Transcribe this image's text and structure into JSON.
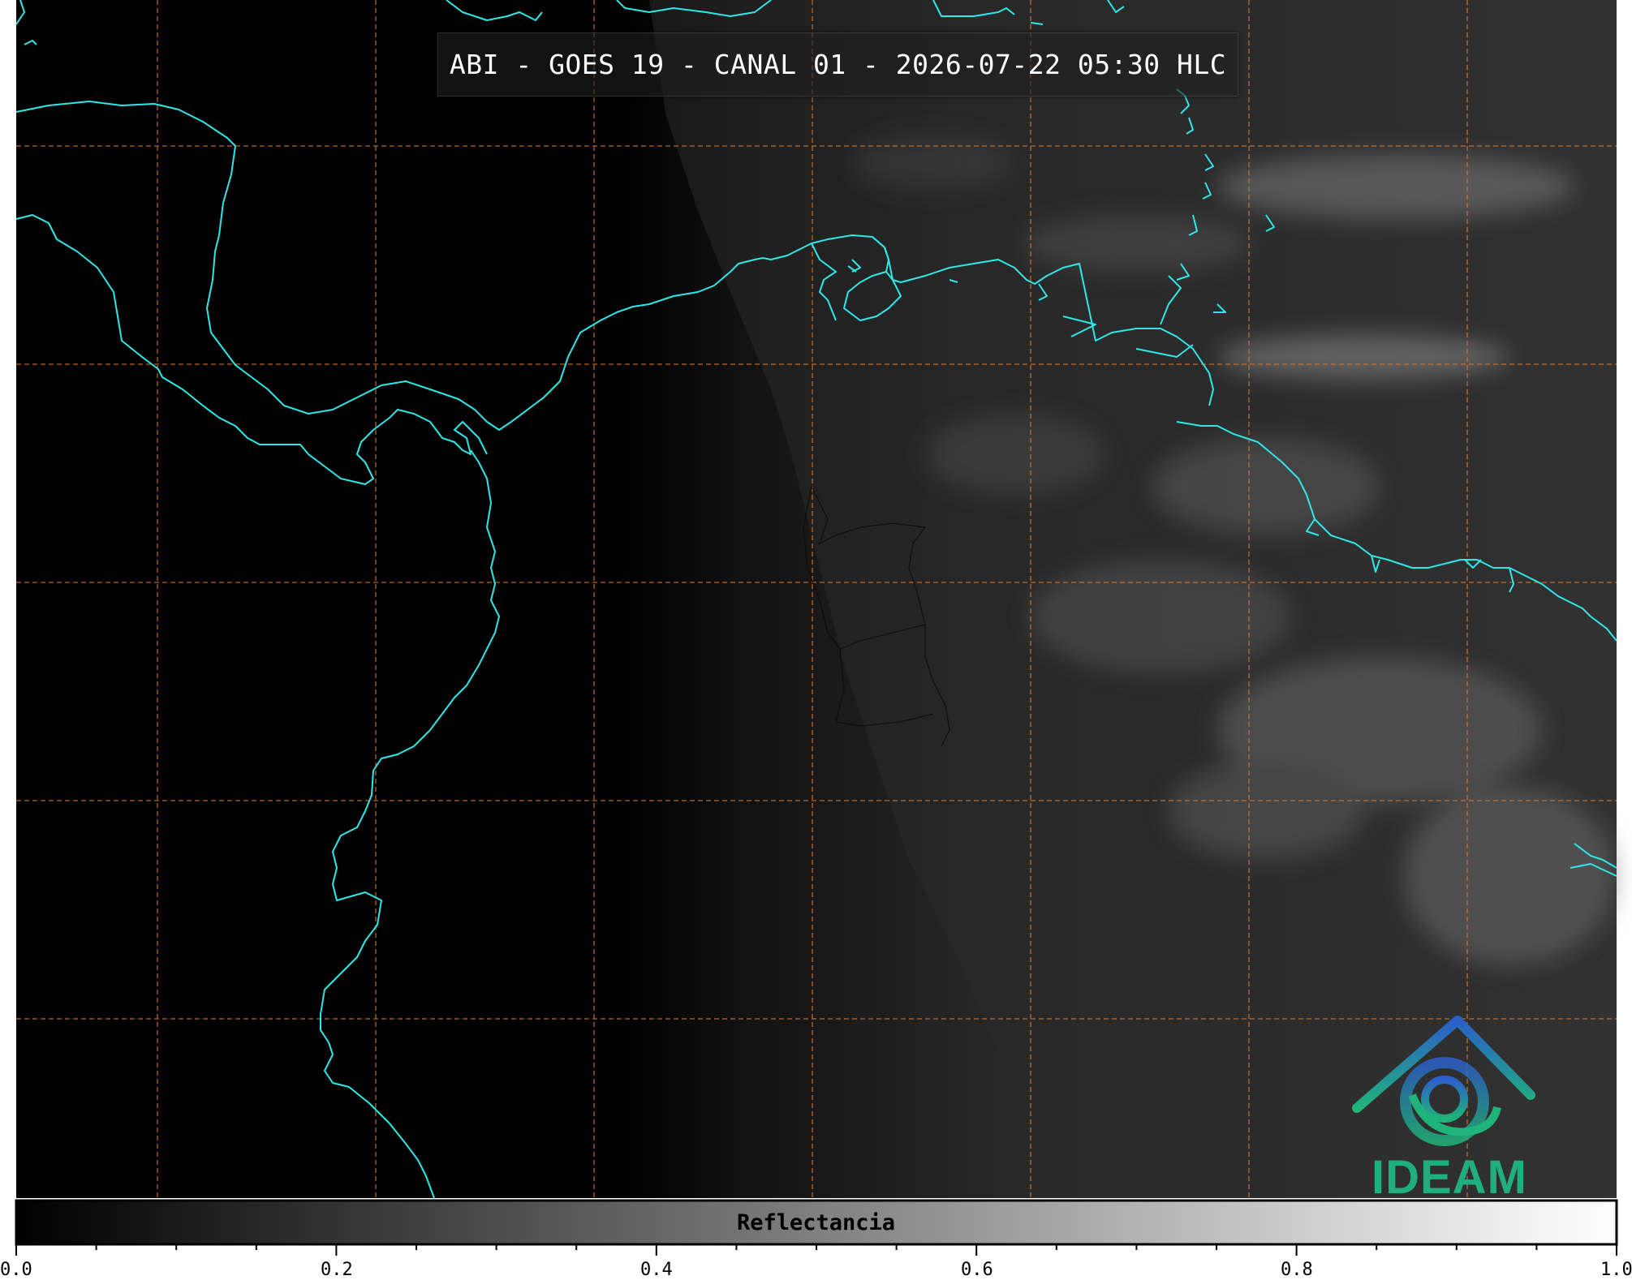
{
  "header": {
    "title": "ABI - GOES 19 - CANAL 01 - 2026-07-22 05:30 HLC"
  },
  "colorbar": {
    "label": "Reflectancia",
    "ticks": [
      "0.0",
      "0.2",
      "0.4",
      "0.6",
      "0.8",
      "1.0"
    ],
    "range": [
      0.0,
      1.0
    ],
    "colormap": [
      "#000000",
      "#ffffff"
    ]
  },
  "map_style": {
    "coastline_color": "#2ee8e8",
    "gridline_color": "#d9762b",
    "background_color": "#000000"
  },
  "logo": {
    "text": "IDEAM",
    "colors": [
      "#2b6cc4",
      "#1fae7e"
    ]
  }
}
